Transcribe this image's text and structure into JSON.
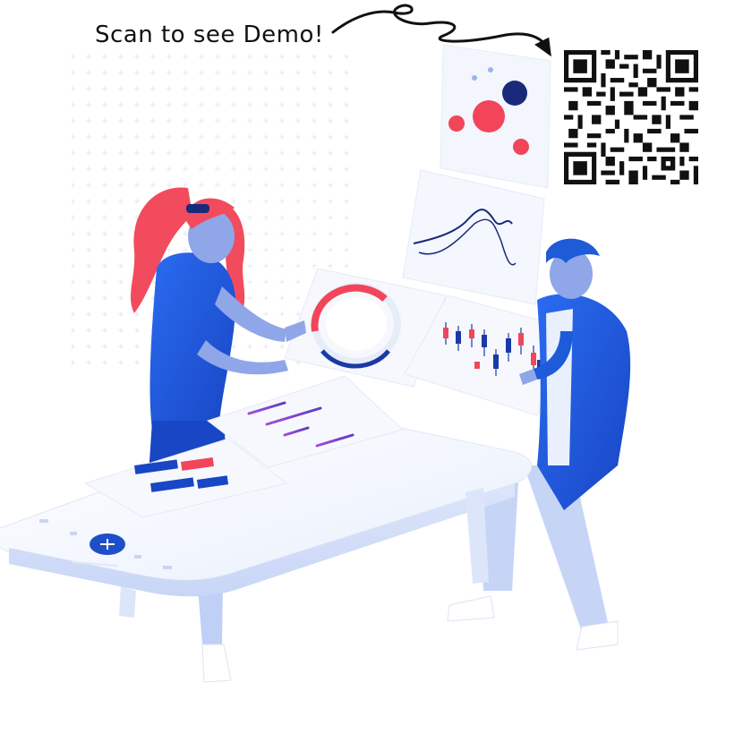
{
  "caption": "Scan to see Demo!",
  "colors": {
    "primary_blue": "#1E5BD8",
    "dark_blue": "#0C2E9A",
    "accent_red": "#F2455A",
    "hair_red": "#F24B5E",
    "skin": "#8FA6E8",
    "panel": "#F4F7FE",
    "purple": "#7A42C8"
  },
  "icons": {
    "qr": "qr-code-icon",
    "arrow": "curly-arrow-icon",
    "plus": "plus-icon"
  }
}
